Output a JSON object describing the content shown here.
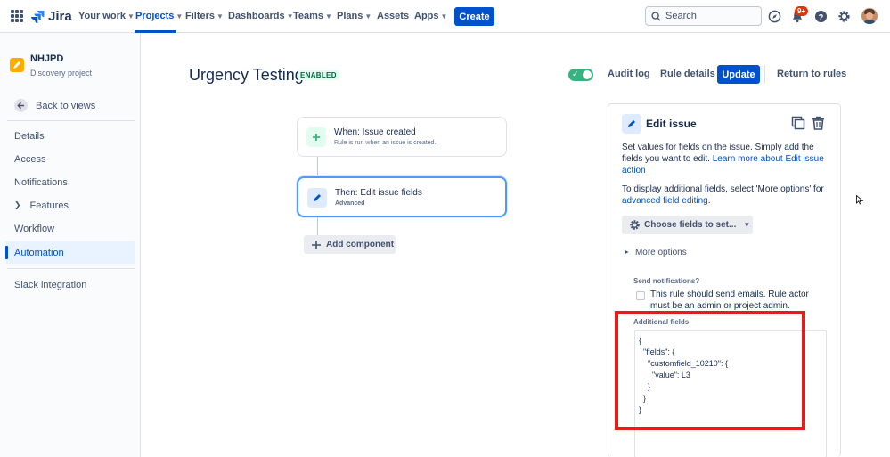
{
  "topnav": {
    "logo": "Jira",
    "items": [
      {
        "label": "Your work",
        "dropdown": true
      },
      {
        "label": "Projects",
        "dropdown": true,
        "active": true
      },
      {
        "label": "Filters",
        "dropdown": true
      },
      {
        "label": "Dashboards",
        "dropdown": true
      },
      {
        "label": "Teams",
        "dropdown": true
      },
      {
        "label": "Plans",
        "dropdown": true
      },
      {
        "label": "Assets",
        "dropdown": false
      },
      {
        "label": "Apps",
        "dropdown": true
      }
    ],
    "create_label": "Create",
    "search_placeholder": "Search",
    "notification_badge": "9+"
  },
  "sidebar": {
    "project_name": "NHJPD",
    "project_type": "Discovery project",
    "back_label": "Back to views",
    "items": [
      {
        "label": "Details"
      },
      {
        "label": "Access"
      },
      {
        "label": "Notifications"
      },
      {
        "label": "Features",
        "expandable": true
      },
      {
        "label": "Workflow"
      },
      {
        "label": "Automation",
        "selected": true
      }
    ],
    "extra_item": "Slack integration"
  },
  "header": {
    "title": "Urgency Testing",
    "status": "ENABLED",
    "toggle_on": true,
    "audit_log": "Audit log",
    "rule_details": "Rule details",
    "update": "Update",
    "return": "Return to rules"
  },
  "flow": {
    "trigger_title": "When: Issue created",
    "trigger_sub": "Rule is run when an issue is created.",
    "action_title": "Then: Edit issue fields",
    "action_sub": "Advanced",
    "add_component": "Add component"
  },
  "panel": {
    "title": "Edit issue",
    "desc_text": "Set values for fields on the issue. Simply add the fields you want to edit. ",
    "desc_link": "Learn more about Edit issue action",
    "adv_text": "To display additional fields, select 'More options' for ",
    "adv_link": "advanced field editing",
    "adv_end": ".",
    "choose_fields": "Choose fields to set...",
    "more_options": "More options",
    "send_notifications_label": "Send notifications?",
    "send_notifications_text": "This rule should send emails. Rule actor must be an admin or project admin.",
    "additional_fields_label": "Additional fields",
    "additional_fields_value": "{\n  \"fields\": {\n    \"customfield_10210\": {\n      \"value\": L3\n    }\n  }\n}"
  },
  "colors": {
    "primary": "#0052cc",
    "toggle_on": "#36b37e",
    "highlight": "#e01e1e",
    "lozenge_bg": "#e3fcef",
    "lozenge_text": "#006644"
  },
  "icons": {
    "app_switcher": "app-switcher-icon",
    "logo": "jira-logo-icon",
    "search": "search-icon",
    "whats_new": "compass-icon",
    "notifications": "bell-icon",
    "help": "help-icon",
    "settings": "gear-icon",
    "back": "arrow-left-icon",
    "trigger": "plus-icon",
    "action": "pencil-icon",
    "duplicate": "duplicate-icon",
    "delete": "trash-icon"
  }
}
